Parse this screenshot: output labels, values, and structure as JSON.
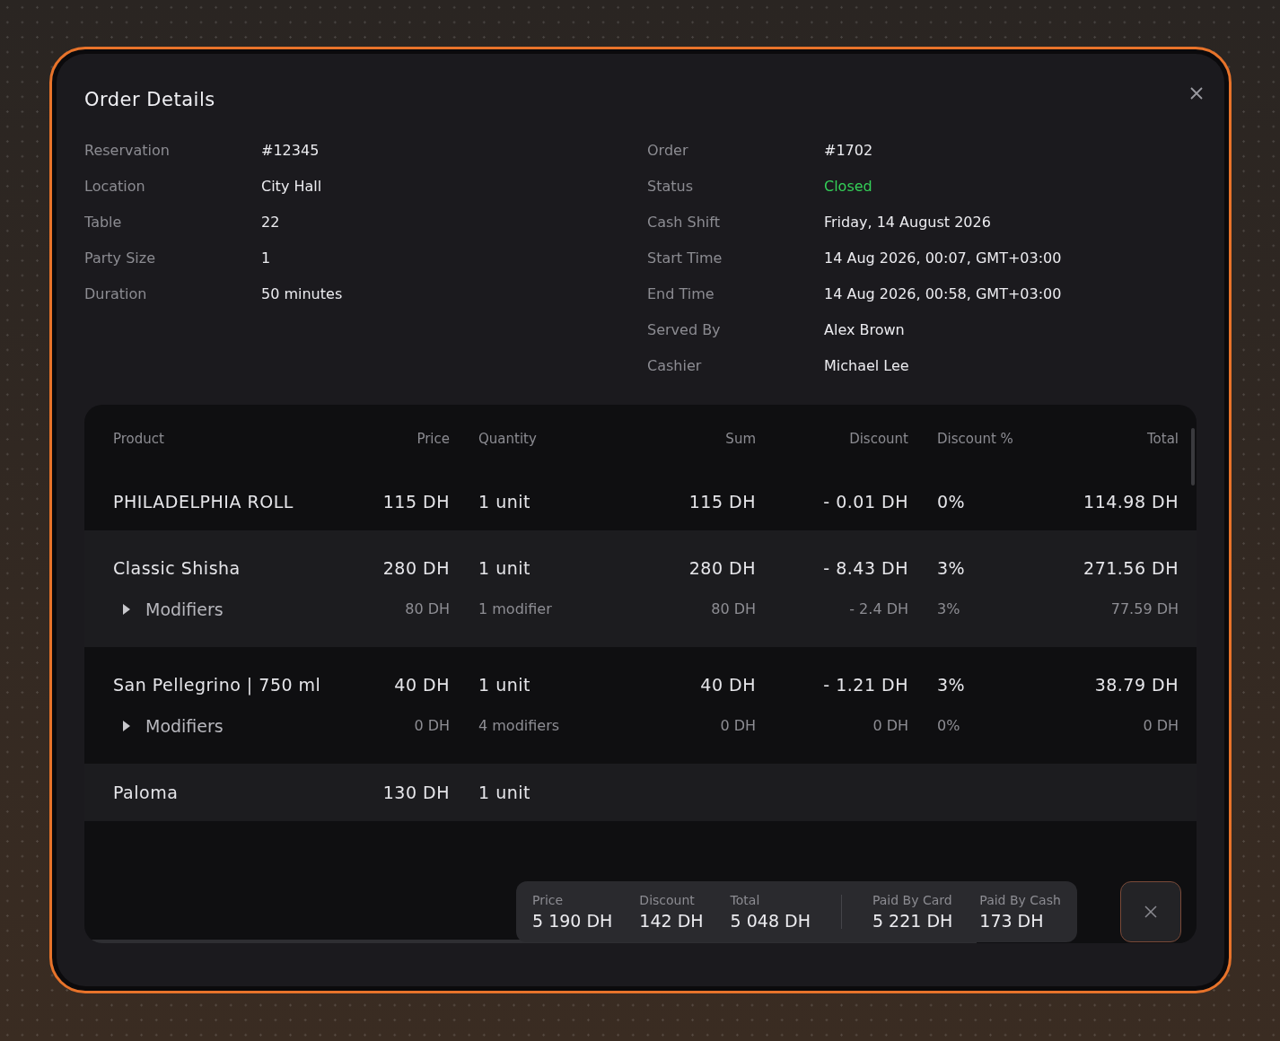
{
  "dialog": {
    "title": "Order Details"
  },
  "reservation_details": [
    {
      "label": "Reservation",
      "value": "#12345"
    },
    {
      "label": "Location",
      "value": "City Hall"
    },
    {
      "label": "Table",
      "value": "22"
    },
    {
      "label": "Party Size",
      "value": "1"
    },
    {
      "label": "Duration",
      "value": "50 minutes"
    }
  ],
  "order_details": [
    {
      "label": "Order",
      "value": "#1702",
      "kind": "plain"
    },
    {
      "label": "Status",
      "value": "Closed",
      "kind": "status"
    },
    {
      "label": "Cash Shift",
      "value": "Friday, 14 August 2026",
      "kind": "plain"
    },
    {
      "label": "Start Time",
      "value": "14 Aug 2026, 00:07, GMT+03:00",
      "kind": "plain"
    },
    {
      "label": "End Time",
      "value": "14 Aug 2026, 00:58, GMT+03:00",
      "kind": "plain"
    },
    {
      "label": "Served By",
      "value": "Alex Brown",
      "kind": "plain"
    },
    {
      "label": "Cashier",
      "value": "Michael Lee",
      "kind": "plain"
    }
  ],
  "table": {
    "columns": [
      "Product",
      "Price",
      "Quantity",
      "Sum",
      "Discount",
      "Discount %",
      "Total"
    ],
    "rows": [
      {
        "cells": [
          "PHILADELPHIA ROLL",
          "115 DH",
          "1 unit",
          "115 DH",
          "- 0.01 DH",
          "0%",
          "114.98 DH"
        ]
      },
      {
        "cells": [
          "Classic Shisha",
          "280 DH",
          "1 unit",
          "280 DH",
          "- 8.43 DH",
          "3%",
          "271.56 DH"
        ],
        "modifiers": {
          "expanded": false,
          "cells": [
            "Modifiers",
            "80 DH",
            "1 modifier",
            "80 DH",
            "- 2.4 DH",
            "3%",
            "77.59 DH"
          ]
        }
      },
      {
        "cells": [
          "San Pellegrino | 750 ml",
          "40 DH",
          "1 unit",
          "40 DH",
          "- 1.21 DH",
          "3%",
          "38.79 DH"
        ],
        "modifiers": {
          "expanded": false,
          "cells": [
            "Modifiers",
            "0 DH",
            "4 modifiers",
            "0 DH",
            "0 DH",
            "0%",
            "0 DH"
          ]
        }
      },
      {
        "cells": [
          "Paloma",
          "130 DH",
          "1 unit"
        ]
      }
    ]
  },
  "summary": {
    "totals": [
      {
        "label": "Price",
        "value": "5 190 DH"
      },
      {
        "label": "Discount",
        "value": "142 DH"
      },
      {
        "label": "Total",
        "value": "5 048 DH"
      }
    ],
    "payments": [
      {
        "label": "Paid By Card",
        "value": "5 221 DH"
      },
      {
        "label": "Paid By Cash",
        "value": "173 DH"
      }
    ]
  }
}
